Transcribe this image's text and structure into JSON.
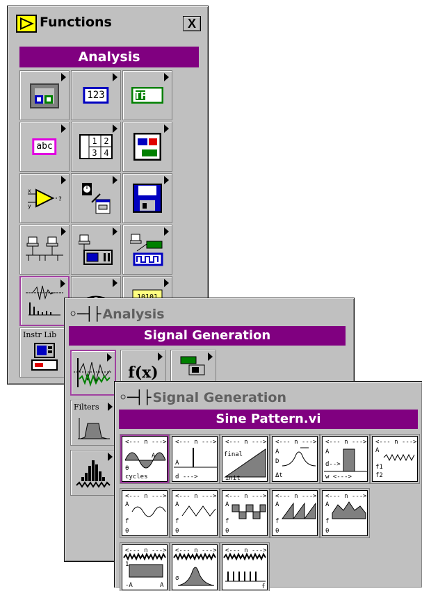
{
  "functions_window": {
    "title": "Functions",
    "close_label": "X",
    "header": "Analysis",
    "icons": {
      "numeric": "123",
      "boolean": "TF",
      "string": "abc",
      "array": [
        "1",
        "2",
        "3",
        "4"
      ],
      "instr_lib_label": "Instr Lib"
    }
  },
  "analysis_window": {
    "title": "Analysis",
    "header": "Signal Generation",
    "formula_label": "f(x)",
    "filters_label": "Filters"
  },
  "signal_generation_window": {
    "title": "Signal Generation",
    "header": "Sine Pattern.vi"
  },
  "colors": {
    "palette_bg": "#c0c0c0",
    "header_purple": "#800080",
    "selection_purple": "#a040a0"
  }
}
